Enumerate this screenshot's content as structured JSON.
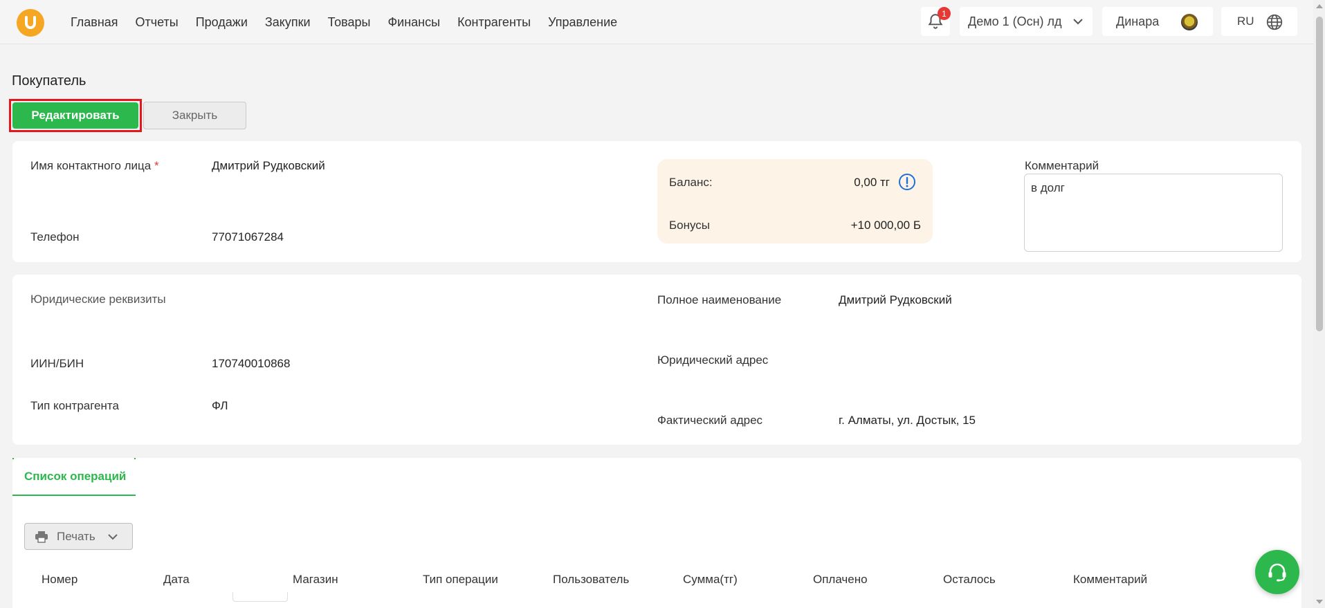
{
  "nav": {
    "items": [
      "Главная",
      "Отчеты",
      "Продажи",
      "Закупки",
      "Товары",
      "Финансы",
      "Контрагенты",
      "Управление"
    ],
    "notifications_count": "1",
    "store": "Демо 1 (Осн) лд",
    "user": "Динара",
    "language": "RU"
  },
  "page": {
    "title": "Покупатель",
    "edit_label": "Редактировать",
    "close_label": "Закрыть"
  },
  "contact": {
    "name_label": "Имя контактного лица",
    "name_required_mark": "*",
    "name_value": "Дмитрий Рудковский",
    "phone_label": "Телефон",
    "phone_value": "77071067284"
  },
  "balance": {
    "balance_label": "Баланс:",
    "balance_value": "0,00 тг",
    "bonus_label": "Бонусы",
    "bonus_value": "+10 000,00 Б"
  },
  "comment": {
    "label": "Комментарий",
    "value": "в долг"
  },
  "legal": {
    "section_title": "Юридические реквизиты",
    "iin_label": "ИИН/БИН",
    "iin_value": "170740010868",
    "type_label": "Тип контрагента",
    "type_value": "ФЛ",
    "full_name_label": "Полное наименование",
    "full_name_value": "Дмитрий Рудковский",
    "legal_address_label": "Юридический адрес",
    "legal_address_value": "",
    "actual_address_label": "Фактический адрес",
    "actual_address_value": "г. Алматы, ул. Достык, 15"
  },
  "operations": {
    "tab_label": "Список операций",
    "print_label": "Печать",
    "columns": [
      "Номер",
      "Дата",
      "Магазин",
      "Тип операции",
      "Пользователь",
      "Сумма(тг)",
      "Оплачено",
      "Осталось",
      "Комментарий"
    ]
  },
  "colors": {
    "accent": "#2db84d",
    "highlight": "#e3171c",
    "balance_bg": "#fdf4e7",
    "logo": "#f5a623"
  }
}
